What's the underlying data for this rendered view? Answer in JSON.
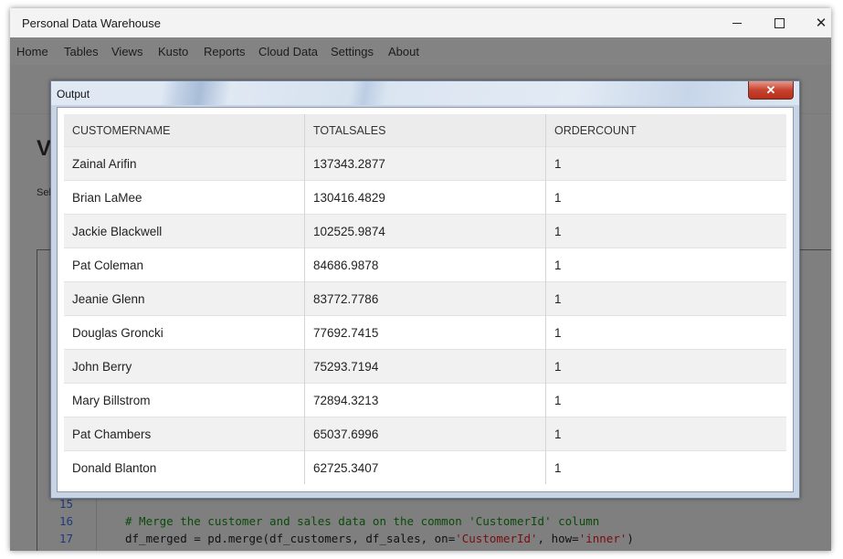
{
  "window": {
    "title": "Personal Data Warehouse",
    "controls": {
      "minimize": "—",
      "maximize": "☐",
      "close": "✕"
    }
  },
  "menu": {
    "items": [
      "Home",
      "Tables",
      "Views",
      "Kusto",
      "Reports",
      "Cloud Data",
      "Settings",
      "About"
    ]
  },
  "background": {
    "heading_fragment": "V",
    "select_fragment": "Sel",
    "code_lines": [
      {
        "number": "15",
        "text": ""
      },
      {
        "number": "16",
        "comment": "# Merge the customer and sales data on the common 'CustomerId' column"
      },
      {
        "number": "17",
        "code_before": "df_merged = pd.merge(df_customers, df_sales, on=",
        "str1": "'CustomerId'",
        "code_mid": ", how=",
        "str2": "'inner'",
        "code_after": ")"
      }
    ]
  },
  "dialog": {
    "title": "Output",
    "close_label": "✕",
    "columns": [
      "CUSTOMERNAME",
      "TOTALSALES",
      "ORDERCOUNT"
    ],
    "rows": [
      [
        "Zainal Arifin",
        "137343.2877",
        "1"
      ],
      [
        "Brian LaMee",
        "130416.4829",
        "1"
      ],
      [
        "Jackie Blackwell",
        "102525.9874",
        "1"
      ],
      [
        "Pat Coleman",
        "84686.9878",
        "1"
      ],
      [
        "Jeanie Glenn",
        "83772.7786",
        "1"
      ],
      [
        "Douglas Groncki",
        "77692.7415",
        "1"
      ],
      [
        "John Berry",
        "75293.7194",
        "1"
      ],
      [
        "Mary Billstrom",
        "72894.3213",
        "1"
      ],
      [
        "Pat Chambers",
        "65037.6996",
        "1"
      ],
      [
        "Donald Blanton",
        "62725.3407",
        "1"
      ]
    ]
  }
}
